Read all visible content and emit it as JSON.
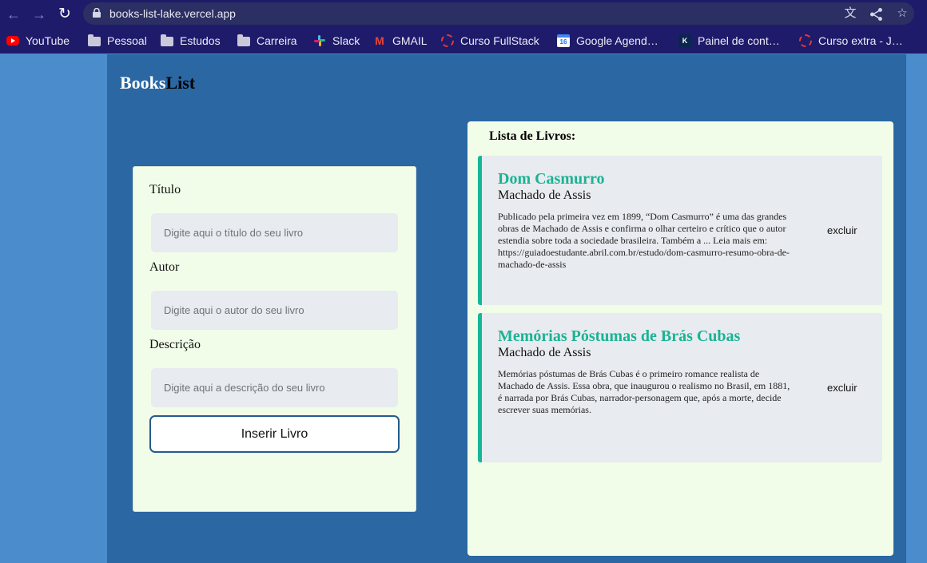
{
  "browser": {
    "url": "books-list-lake.vercel.app",
    "bookmarks": [
      {
        "label": "YouTube",
        "icon": "youtube-icon"
      },
      {
        "label": "Pessoal",
        "icon": "folder-icon"
      },
      {
        "label": "Estudos",
        "icon": "folder-icon"
      },
      {
        "label": "Carreira",
        "icon": "folder-icon"
      },
      {
        "label": "Slack",
        "icon": "slack-icon"
      },
      {
        "label": "GMAIL",
        "icon": "gmail-icon"
      },
      {
        "label": "Curso FullStack",
        "icon": "ring-icon"
      },
      {
        "label": "Google Agend…",
        "icon": "calendar-icon"
      },
      {
        "label": "Painel de cont…",
        "icon": "panel-icon"
      },
      {
        "label": "Curso extra - J…",
        "icon": "ring-icon"
      }
    ],
    "calendar_day": "16",
    "panel_mark": "K"
  },
  "app": {
    "brand_part1": "Books",
    "brand_part2": "List",
    "form": {
      "title_label": "Título",
      "title_placeholder": "Digite aqui o título do seu livro",
      "author_label": "Autor",
      "author_placeholder": "Digite aqui o autor do seu livro",
      "description_label": "Descrição",
      "description_placeholder": "Digite aqui a descrição do seu livro",
      "submit_label": "Inserir Livro"
    },
    "list": {
      "heading": "Lista de Livros:",
      "books": [
        {
          "title": "Dom Casmurro",
          "author": "Machado de Assis",
          "description": "Publicado pela primeira vez em 1899, “Dom Casmurro” é uma das grandes obras de Machado de Assis e confirma o olhar certeiro e crítico que o autor estendia sobre toda a sociedade brasileira. Também a ... Leia mais em: https://guiadoestudante.abril.com.br/estudo/dom-casmurro-resumo-obra-de-machado-de-assis",
          "delete_label": "excluir"
        },
        {
          "title": "Memórias Póstumas de Brás Cubas",
          "author": "Machado de Assis",
          "description": "Memórias póstumas de Brás Cubas é o primeiro romance realista de Machado de Assis. Essa obra, que inaugurou o realismo no Brasil, em 1881, é narrada por Brás Cubas, narrador-personagem que, após a morte, decide escrever suas memórias.",
          "delete_label": "excluir"
        }
      ]
    }
  },
  "colors": {
    "page_bg": "#4b8ccc",
    "app_bg": "#2a67a3",
    "card_bg": "#f1fde8",
    "accent": "#1bb394",
    "chrome": "#1f1b6b"
  }
}
